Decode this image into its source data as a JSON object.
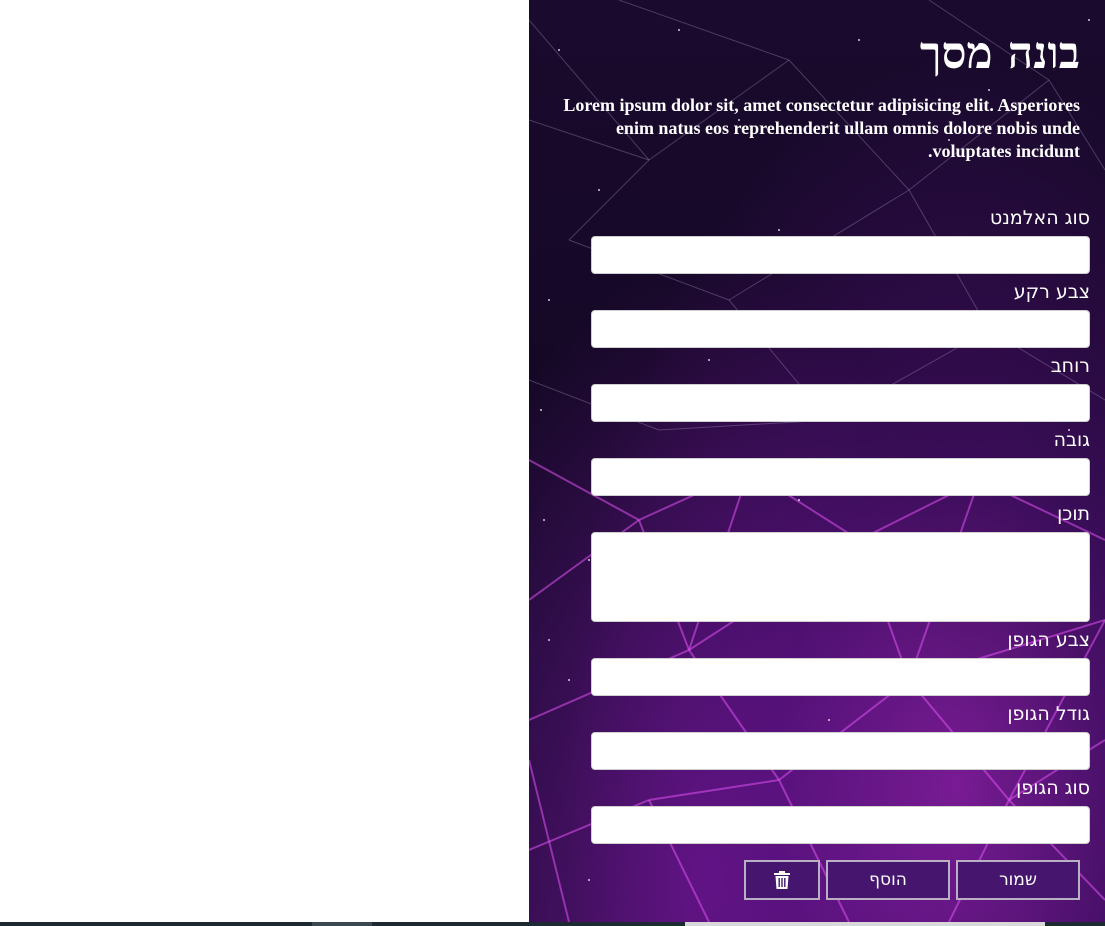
{
  "header": {
    "title": "בונה מסך",
    "subtitle": "Lorem ipsum dolor sit, amet consectetur adipisicing elit. Asperiores enim natus eos reprehenderit ullam omnis dolore nobis unde voluptates incidunt."
  },
  "form": {
    "fields": [
      {
        "label": "סוג האלמנט",
        "value": "",
        "kind": "input"
      },
      {
        "label": "צבע רקע",
        "value": "",
        "kind": "input"
      },
      {
        "label": "רוחב",
        "value": "",
        "kind": "input"
      },
      {
        "label": "גובה",
        "value": "",
        "kind": "input"
      },
      {
        "label": "תוכן",
        "value": "",
        "kind": "textarea"
      },
      {
        "label": "צבע הגופן",
        "value": "",
        "kind": "input"
      },
      {
        "label": "גודל הגופן",
        "value": "",
        "kind": "input"
      },
      {
        "label": "סוג הגופן",
        "value": "",
        "kind": "input"
      }
    ]
  },
  "buttons": {
    "save_label": "שמור",
    "add_label": "הוסף",
    "delete_icon": "trash-icon"
  },
  "colors": {
    "button_bg": "#46166f",
    "panel_bg": "#1a0a2e",
    "accent": "#c23be0"
  }
}
